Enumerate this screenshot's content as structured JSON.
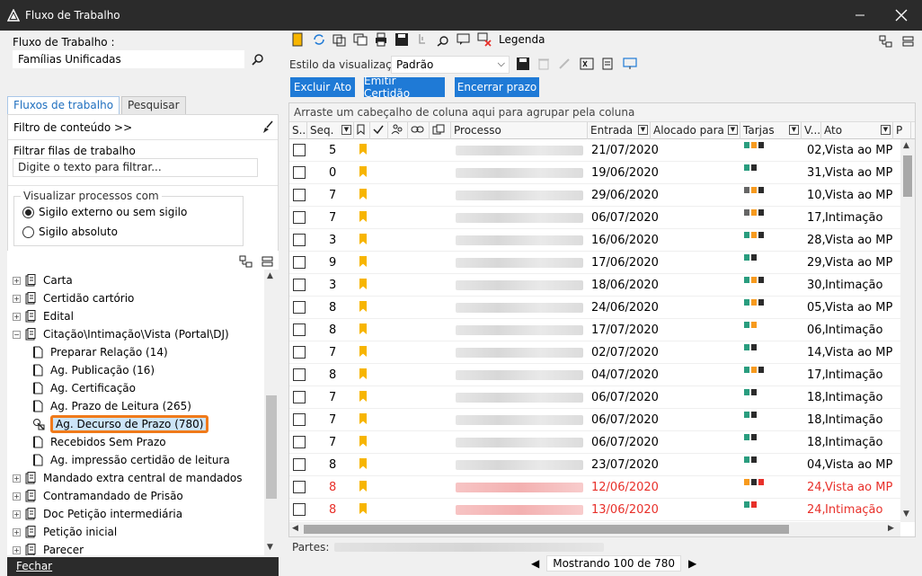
{
  "window": {
    "title": "Fluxo de Trabalho"
  },
  "left": {
    "workflow_label": "Fluxo de Trabalho :",
    "workflow_value": "Famílias Unificadas",
    "tabs": [
      "Fluxos de trabalho",
      "Pesquisar"
    ],
    "content_filter": "Filtro de conteúdo >>",
    "filter_label": "Filtrar filas de trabalho",
    "filter_placeholder": "Digite o texto para filtrar...",
    "view_group": "Visualizar processos com",
    "radio1": "Sigilo externo ou sem sigilo",
    "radio2": "Sigilo absoluto",
    "tree": [
      {
        "label": "Carta",
        "level": 0,
        "expand": "+"
      },
      {
        "label": "Certidão cartório",
        "level": 0,
        "expand": "+"
      },
      {
        "label": "Edital",
        "level": 0,
        "expand": "+"
      },
      {
        "label": "Citação\\Intimação\\Vista (Portal\\DJ)",
        "level": 0,
        "expand": "−"
      },
      {
        "label": "Preparar Relação (14)",
        "level": 1
      },
      {
        "label": "Ag. Publicação (16)",
        "level": 1
      },
      {
        "label": "Ag. Certificação",
        "level": 1
      },
      {
        "label": "Ag. Prazo de Leitura (265)",
        "level": 1
      },
      {
        "label": "Ag. Decurso de Prazo (780)",
        "level": 1,
        "selected": true
      },
      {
        "label": "Recebidos Sem Prazo",
        "level": 1
      },
      {
        "label": "Ag. impressão certidão de leitura",
        "level": 1
      },
      {
        "label": "Mandado extra central de mandados",
        "level": 0,
        "expand": "+"
      },
      {
        "label": "Contramandado de Prisão",
        "level": 0,
        "expand": "+"
      },
      {
        "label": "Doc Petição intermediária",
        "level": 0,
        "expand": "+"
      },
      {
        "label": "Petição inicial",
        "level": 0,
        "expand": "+"
      },
      {
        "label": "Parecer",
        "level": 0,
        "expand": "+"
      }
    ],
    "close_label": "Fechar"
  },
  "right": {
    "legend": "Legenda",
    "view_style_label": "Estilo da visualização",
    "view_style_value": "Padrão",
    "buttons": [
      "Excluir Ato",
      "Emitir Certidão",
      "Encerrar prazo"
    ],
    "group_hint": "Arraste um cabeçalho de coluna aqui para agrupar pela coluna",
    "columns": [
      "S...",
      "Seq.",
      "Processo",
      "Entrada",
      "Alocado para ...",
      "Tarjas",
      "V...",
      "Ato",
      "P"
    ],
    "rows": [
      {
        "seq": "5",
        "date": "21/07/2020",
        "v": "02,",
        "ato": "Vista ao MP",
        "tarja": [
          "#2a9d7f",
          "#f79a1e",
          "#2b2b2b"
        ],
        "red": false
      },
      {
        "seq": "0",
        "date": "19/06/2020",
        "v": "31,",
        "ato": "Vista ao MP",
        "tarja": [
          "#2a9d7f",
          "#2b2b2b"
        ],
        "red": false
      },
      {
        "seq": "7",
        "date": "29/06/2020",
        "v": "10,",
        "ato": "Vista ao MP",
        "tarja": [
          "#666666",
          "#f79a1e",
          "#2b2b2b"
        ],
        "red": false
      },
      {
        "seq": "7",
        "date": "06/07/2020",
        "v": "17,",
        "ato": "Intimação",
        "tarja": [
          "#666666",
          "#f79a1e",
          "#2b2b2b"
        ],
        "red": false
      },
      {
        "seq": "3",
        "date": "16/06/2020",
        "v": "28,",
        "ato": "Vista ao MP",
        "tarja": [
          "#2a9d7f",
          "#f79a1e",
          "#2b2b2b"
        ],
        "red": false
      },
      {
        "seq": "9",
        "date": "17/06/2020",
        "v": "29,",
        "ato": "Vista ao MP",
        "tarja": [
          "#2a9d7f",
          "#2b2b2b"
        ],
        "red": false
      },
      {
        "seq": "3",
        "date": "18/06/2020",
        "v": "30,",
        "ato": "Intimação",
        "tarja": [
          "#2a9d7f",
          "#f79a1e",
          "#2b2b2b"
        ],
        "red": false
      },
      {
        "seq": "8",
        "date": "24/06/2020",
        "v": "05,",
        "ato": "Vista ao MP",
        "tarja": [
          "#2a9d7f",
          "#f79a1e",
          "#2b2b2b"
        ],
        "red": false
      },
      {
        "seq": "8",
        "date": "17/07/2020",
        "v": "06,",
        "ato": "Intimação",
        "tarja": [
          "#2a9d7f",
          "#f79a1e"
        ],
        "red": false
      },
      {
        "seq": "7",
        "date": "02/07/2020",
        "v": "14,",
        "ato": "Vista ao MP",
        "tarja": [
          "#2a9d7f",
          "#2b2b2b"
        ],
        "red": false
      },
      {
        "seq": "8",
        "date": "04/07/2020",
        "v": "17,",
        "ato": "Intimação",
        "tarja": [
          "#2a9d7f",
          "#f79a1e",
          "#2b2b2b"
        ],
        "red": false
      },
      {
        "seq": "7",
        "date": "06/07/2020",
        "v": "18,",
        "ato": "Intimação",
        "tarja": [
          "#2a9d7f",
          "#2b2b2b"
        ],
        "red": false
      },
      {
        "seq": "7",
        "date": "06/07/2020",
        "v": "18,",
        "ato": "Intimação",
        "tarja": [
          "#2a9d7f",
          "#2b2b2b"
        ],
        "red": false
      },
      {
        "seq": "7",
        "date": "06/07/2020",
        "v": "18,",
        "ato": "Intimação",
        "tarja": [
          "#2a9d7f",
          "#2b2b2b"
        ],
        "red": false
      },
      {
        "seq": "8",
        "date": "23/07/2020",
        "v": "04,",
        "ato": "Vista ao MP",
        "tarja": [
          "#2a9d7f",
          "#2b2b2b"
        ],
        "red": false
      },
      {
        "seq": "8",
        "date": "12/06/2020",
        "v": "24,",
        "ato": "Vista ao MP",
        "tarja": [
          "#f79a1e",
          "#2b2b2b",
          "#e8302a"
        ],
        "red": true
      },
      {
        "seq": "8",
        "date": "13/06/2020",
        "v": "24,",
        "ato": "Intimação",
        "tarja": [
          "#2a9d7f",
          "#e8302a"
        ],
        "red": true
      }
    ],
    "partes_label": "Partes:",
    "pager": "Mostrando 100 de 780"
  }
}
